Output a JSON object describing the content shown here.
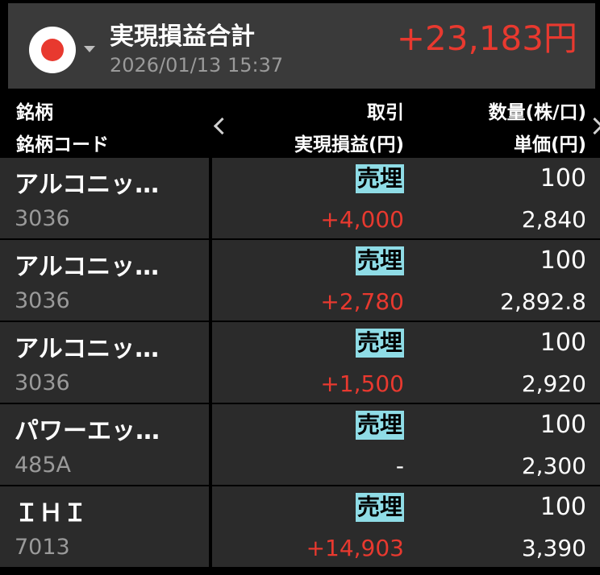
{
  "summary": {
    "title": "実現損益合計",
    "date": "2026/01/13 15:37",
    "total": "+23,183円"
  },
  "header": {
    "col1_line1": "銘柄",
    "col1_line2": "銘柄コード",
    "col2_line1": "取引",
    "col2_line2": "実現損益(円)",
    "col3_line1": "数量(株/口)",
    "col3_line2": "単価(円)"
  },
  "rows": [
    {
      "name": "アルコニッ…",
      "code": "3036",
      "trade": "売埋",
      "pnl": "+4,000",
      "qty": "100",
      "price": "2,840"
    },
    {
      "name": "アルコニッ…",
      "code": "3036",
      "trade": "売埋",
      "pnl": "+2,780",
      "qty": "100",
      "price": "2,892.8"
    },
    {
      "name": "アルコニッ…",
      "code": "3036",
      "trade": "売埋",
      "pnl": "+1,500",
      "qty": "100",
      "price": "2,920"
    },
    {
      "name": "パワーエッ…",
      "code": "485A",
      "trade": "売埋",
      "pnl": "-",
      "qty": "100",
      "price": "2,300"
    },
    {
      "name": "ＩＨＩ",
      "code": "7013",
      "trade": "売埋",
      "pnl": "+14,903",
      "qty": "100",
      "price": "3,390"
    }
  ],
  "colors": {
    "profit": "#e8392f",
    "badge": "#8fdce6",
    "row_bg": "#2b2b2b"
  },
  "icons": {
    "flag": "japan-flag-icon",
    "dropdown": "caret-down-icon",
    "prev": "chevron-left-icon",
    "next": "chevron-right-icon"
  }
}
